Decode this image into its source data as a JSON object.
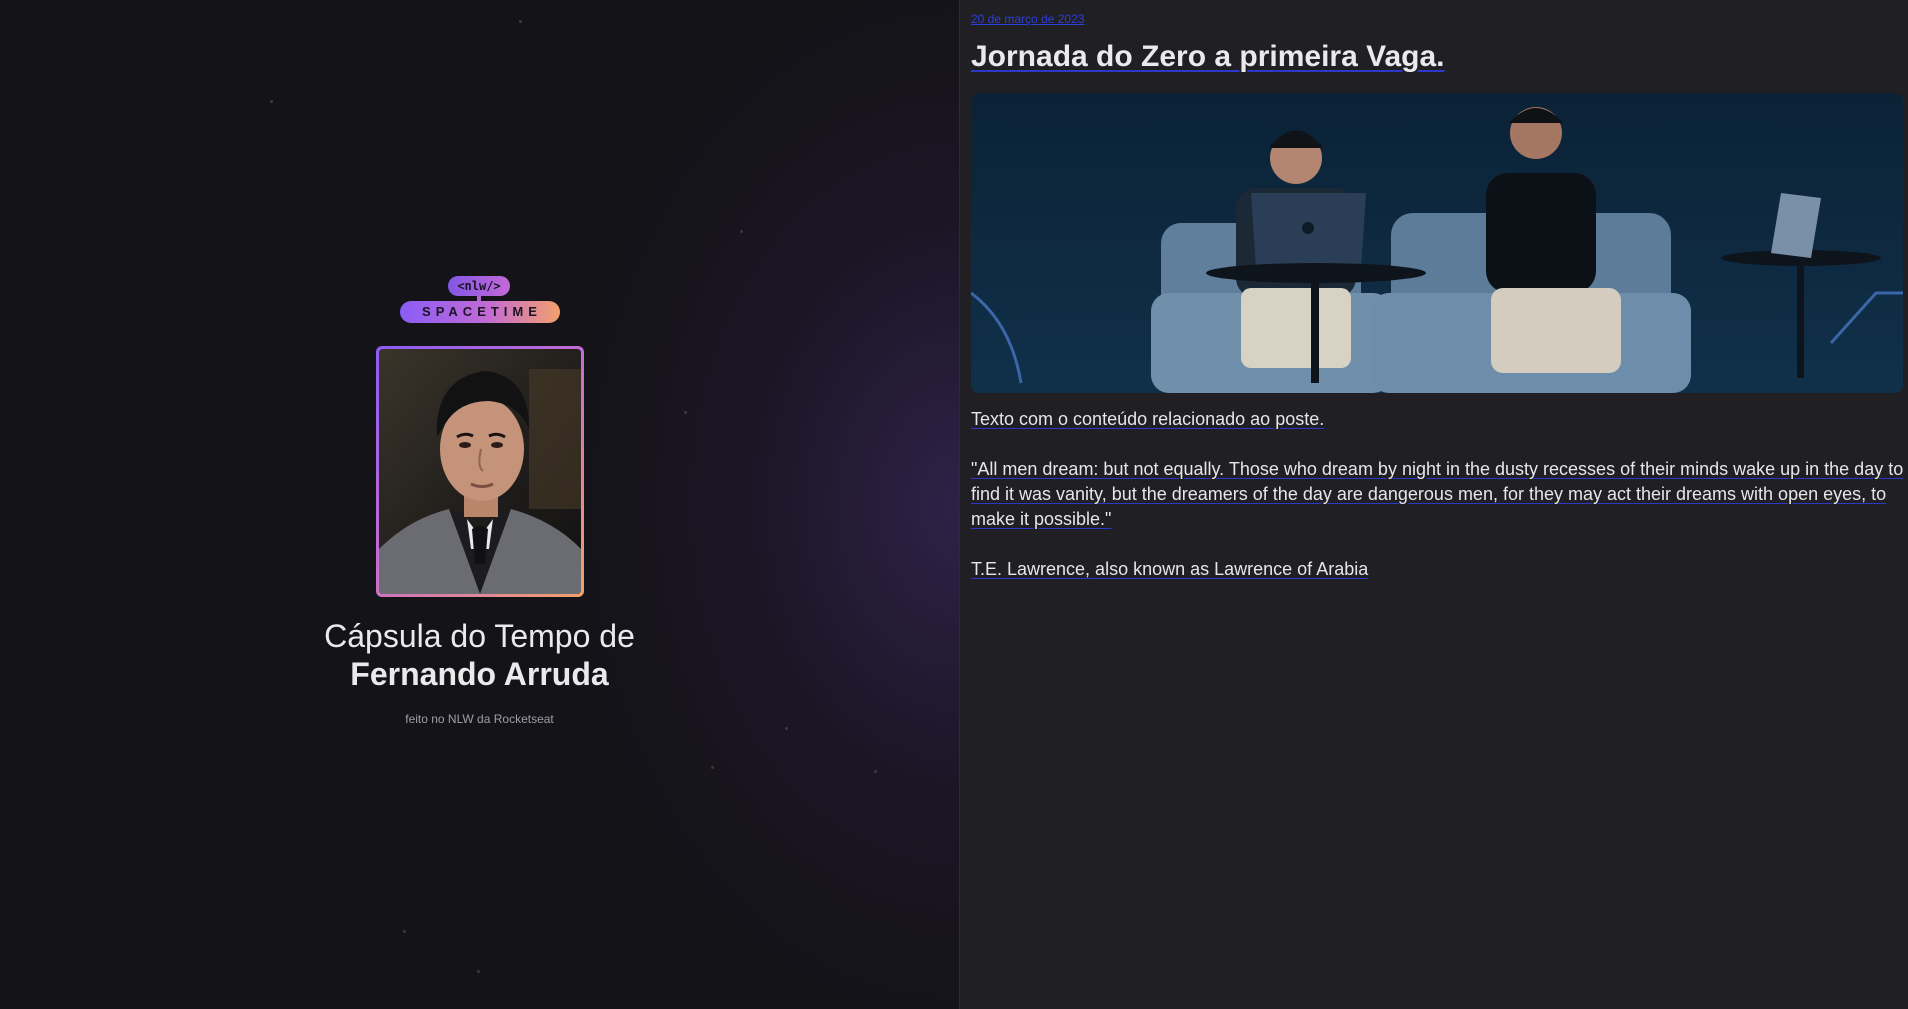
{
  "logo": {
    "tag": "<nlw/>",
    "name": "SPACETIME"
  },
  "profile": {
    "headline_prefix": "Cápsula do Tempo de",
    "name": "Fernando Arruda",
    "footer": "feito no NLW da Rocketseat"
  },
  "memory": {
    "date": "20 de março de 2023",
    "title": "Jornada do Zero a primeira Vaga.",
    "paragraphs": [
      "Texto com o conteúdo relacionado ao poste.",
      "\"All men dream: but not equally. Those who dream by night in the dusty recesses of their minds wake up in the day to find it was vanity, but the dreamers of the day are dangerous men, for they may act their dreams with open eyes, to make it possible.\"",
      "T.E. Lawrence, also known as Lawrence of Arabia"
    ]
  },
  "colors": {
    "link": "#2d3fd6",
    "gradient_start": "#8b5cf6",
    "gradient_end": "#f4a06b"
  }
}
